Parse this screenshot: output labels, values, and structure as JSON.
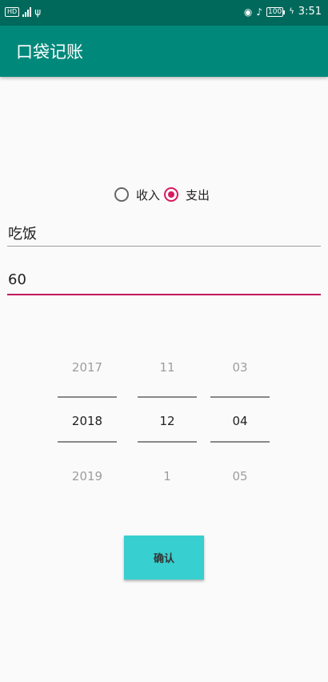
{
  "status_bar": {
    "left_icons": [
      "hd-icon",
      "signal-icon",
      "usb-icon"
    ],
    "hd_label": "HD",
    "battery_level": "100",
    "time": "3:51"
  },
  "app_bar": {
    "title": "口袋记账"
  },
  "colors": {
    "status_bar": "#00695c",
    "app_bar": "#00897b",
    "accent": "#d81b60",
    "button": "#37cfcf"
  },
  "type_selector": {
    "options": [
      {
        "label": "收入",
        "checked": false
      },
      {
        "label": "支出",
        "checked": true
      }
    ]
  },
  "fields": {
    "description": {
      "value": "吃饭"
    },
    "amount": {
      "value": "60"
    }
  },
  "date_picker": {
    "year": {
      "above": "2017",
      "selected": "2018",
      "below": "2019"
    },
    "month": {
      "above": "11",
      "selected": "12",
      "below": "1"
    },
    "day": {
      "above": "03",
      "selected": "04",
      "below": "05"
    }
  },
  "confirm_button": {
    "label": "确认"
  }
}
